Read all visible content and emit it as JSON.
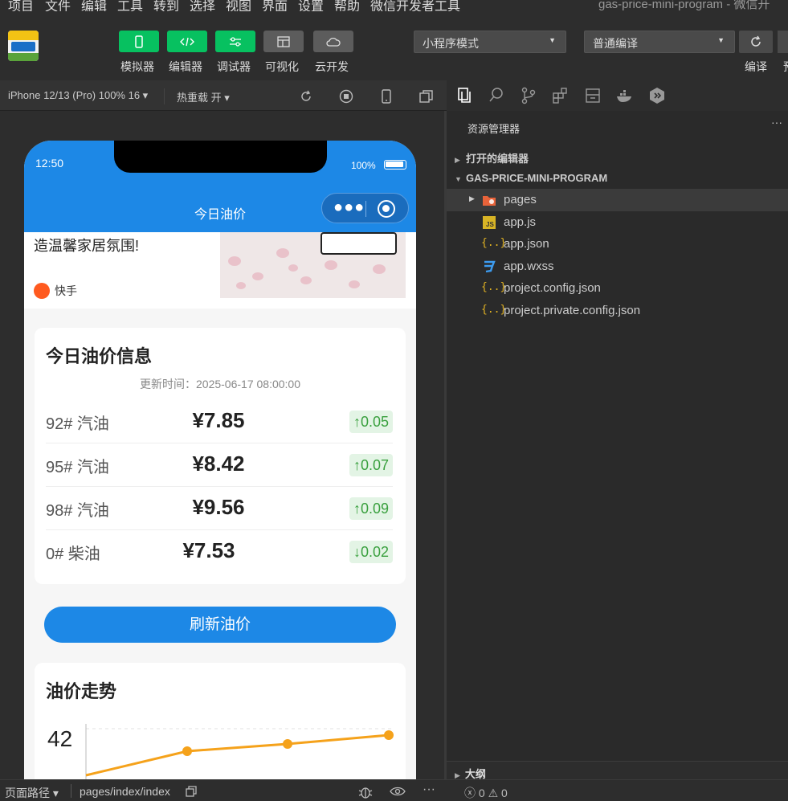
{
  "menubar": {
    "items": [
      "项目",
      "文件",
      "编辑",
      "工具",
      "转到",
      "选择",
      "视图",
      "界面",
      "设置",
      "帮助",
      "微信开发者工具"
    ],
    "window_title": "gas-price-mini-program - 微信开"
  },
  "toolbar": {
    "buttons": [
      {
        "label": "模拟器",
        "icon": "phone-icon"
      },
      {
        "label": "编辑器",
        "icon": "code-icon"
      },
      {
        "label": "调试器",
        "icon": "debug-icon"
      },
      {
        "label": "可视化",
        "icon": "layout-icon"
      },
      {
        "label": "云开发",
        "icon": "cloud-icon"
      }
    ],
    "mode_select": "小程序模式",
    "compile_select": "普通编译",
    "compile_label": "编译",
    "extra_label": "预"
  },
  "simbar": {
    "device": "iPhone 12/13 (Pro) 100% 16 ▾",
    "hotreload": "热重载 开 ▾"
  },
  "phone": {
    "time": "12:50",
    "battery": "100%",
    "nav_title": "今日油价",
    "ad": {
      "text": "造温馨家居氛围!",
      "source": "快手"
    },
    "price_card": {
      "title": "今日油价信息",
      "updated": "更新时间：2025-06-17 08:00:00",
      "rows": [
        {
          "name": "92# 汽油",
          "price": "¥7.85",
          "change": "↑0.05"
        },
        {
          "name": "95# 汽油",
          "price": "¥8.42",
          "change": "↑0.07"
        },
        {
          "name": "98# 汽油",
          "price": "¥9.56",
          "change": "↑0.09"
        },
        {
          "name": "0# 柴油",
          "price": "¥7.53",
          "change": "↓0.02"
        }
      ]
    },
    "refresh_label": "刷新油价",
    "trend": {
      "title": "油价走势",
      "y_tick": "42"
    }
  },
  "explorer": {
    "title": "资源管理器",
    "open_editors": "打开的编辑器",
    "project": "GAS-PRICE-MINI-PROGRAM",
    "files": [
      {
        "name": "pages",
        "icon": "folder-icon"
      },
      {
        "name": "app.js",
        "icon": "js-file-icon"
      },
      {
        "name": "app.json",
        "icon": "json-file-icon"
      },
      {
        "name": "app.wxss",
        "icon": "css-file-icon"
      },
      {
        "name": "project.config.json",
        "icon": "json-file-icon"
      },
      {
        "name": "project.private.config.json",
        "icon": "json-file-icon"
      }
    ],
    "outline": "大纲"
  },
  "footer": {
    "path_label": "页面路径 ▾",
    "page_path": "pages/index/index",
    "errors": "ⓧ 0 ⚠ 0"
  }
}
